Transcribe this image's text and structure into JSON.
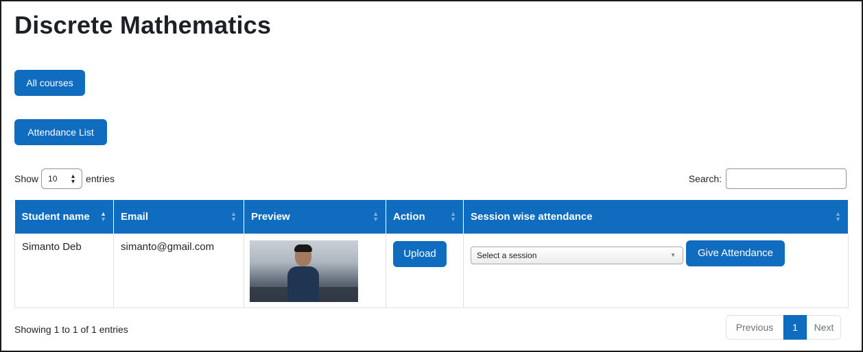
{
  "page": {
    "title": "Discrete Mathematics"
  },
  "buttons": {
    "all_courses": "All courses",
    "attendance_list": "Attendance List"
  },
  "table_controls": {
    "show_label": "Show",
    "length_value": "10",
    "entries_label": "entries",
    "search_label": "Search:",
    "search_value": ""
  },
  "table": {
    "columns": [
      "Student name",
      "Email",
      "Preview",
      "Action",
      "Session wise attendance"
    ],
    "rows": [
      {
        "student_name": "Simanto Deb",
        "email": "simanto@gmail.com",
        "preview": "webcam photo of student",
        "action_label": "Upload",
        "session_placeholder": "Select a session",
        "give_attendance_label": "Give Attendance"
      }
    ]
  },
  "footer": {
    "info": "Showing 1 to 1 of 1 entries",
    "pagination": {
      "previous": "Previous",
      "current": "1",
      "next": "Next"
    }
  },
  "colors": {
    "primary": "#0f6cbf",
    "text": "#1d2125",
    "border": "#dee2e6"
  }
}
